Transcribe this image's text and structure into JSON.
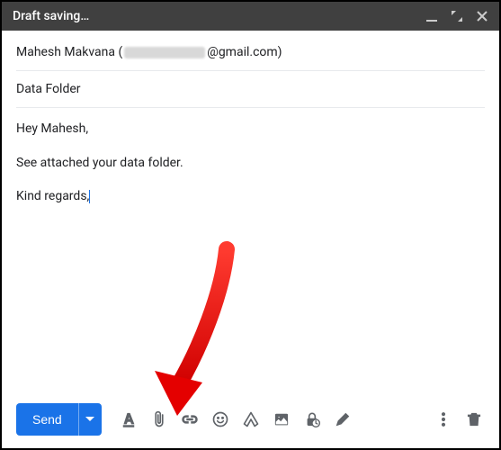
{
  "header": {
    "title": "Draft saving…"
  },
  "to": {
    "name": "Mahesh Makvana",
    "domain": "@gmail.com"
  },
  "subject": "Data Folder",
  "body": {
    "line1": "Hey Mahesh,",
    "line2": "See attached your data folder.",
    "line3": "Kind regards,"
  },
  "toolbar": {
    "send_label": "Send"
  },
  "icons": {
    "minimize": "minimize",
    "expand": "expand",
    "close": "close",
    "format": "format-text",
    "attach": "attach-file",
    "link": "insert-link",
    "emoji": "insert-emoji",
    "drive": "insert-drive",
    "photo": "insert-photo",
    "confidential": "confidential-mode",
    "pen": "insert-signature",
    "more": "more-options",
    "trash": "discard-draft"
  }
}
